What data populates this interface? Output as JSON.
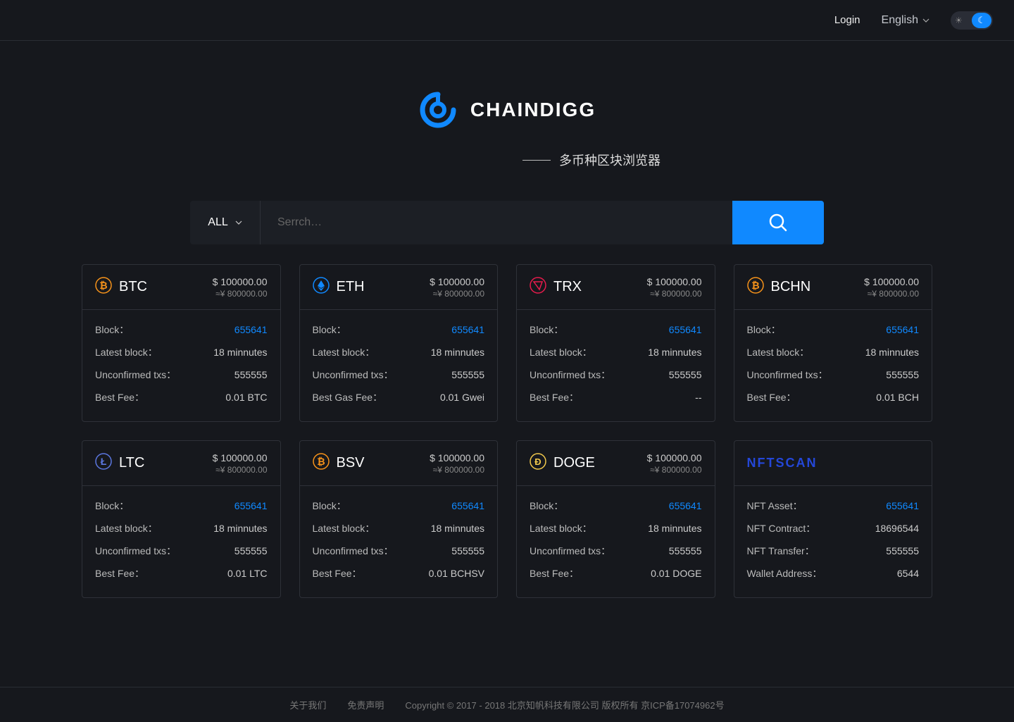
{
  "header": {
    "login": "Login",
    "language": "English"
  },
  "brand": "CHAINDIGG",
  "tagline": "多币种区块浏览器",
  "search": {
    "filter": "ALL",
    "placeholder": "Serrch…"
  },
  "cards": [
    {
      "symbol": "BTC",
      "icon": "btc",
      "iconColor": "#f7931a",
      "priceUsd": "$ 100000.00",
      "priceCny": "≈¥ 800000.00",
      "rows": [
        {
          "label": "Block：",
          "value": "655641",
          "link": true
        },
        {
          "label": "Latest block：",
          "value": "18 minnutes"
        },
        {
          "label": "Unconfirmed txs：",
          "value": "555555"
        },
        {
          "label": "Best Fee：",
          "value": "0.01 BTC"
        }
      ]
    },
    {
      "symbol": "ETH",
      "icon": "eth",
      "iconColor": "#1089ff",
      "priceUsd": "$ 100000.00",
      "priceCny": "≈¥ 800000.00",
      "rows": [
        {
          "label": "Block：",
          "value": "655641",
          "link": true
        },
        {
          "label": "Latest block：",
          "value": "18 minnutes"
        },
        {
          "label": "Unconfirmed txs：",
          "value": "555555"
        },
        {
          "label": "Best Gas Fee：",
          "value": "0.01 Gwei"
        }
      ]
    },
    {
      "symbol": "TRX",
      "icon": "trx",
      "iconColor": "#e61b4c",
      "priceUsd": "$ 100000.00",
      "priceCny": "≈¥ 800000.00",
      "rows": [
        {
          "label": "Block：",
          "value": "655641",
          "link": true
        },
        {
          "label": "Latest block：",
          "value": "18 minnutes"
        },
        {
          "label": "Unconfirmed txs：",
          "value": "555555"
        },
        {
          "label": "Best Fee：",
          "value": "--"
        }
      ]
    },
    {
      "symbol": "BCHN",
      "icon": "bch",
      "iconColor": "#f7931a",
      "priceUsd": "$ 100000.00",
      "priceCny": "≈¥ 800000.00",
      "rows": [
        {
          "label": "Block：",
          "value": "655641",
          "link": true
        },
        {
          "label": "Latest block：",
          "value": "18 minnutes"
        },
        {
          "label": "Unconfirmed txs：",
          "value": "555555"
        },
        {
          "label": "Best Fee：",
          "value": "0.01 BCH"
        }
      ]
    },
    {
      "symbol": "LTC",
      "icon": "ltc",
      "iconColor": "#5b77e0",
      "priceUsd": "$ 100000.00",
      "priceCny": "≈¥ 800000.00",
      "rows": [
        {
          "label": "Block：",
          "value": "655641",
          "link": true
        },
        {
          "label": "Latest block：",
          "value": "18 minnutes"
        },
        {
          "label": "Unconfirmed txs：",
          "value": "555555"
        },
        {
          "label": "Best Fee：",
          "value": "0.01 LTC"
        }
      ]
    },
    {
      "symbol": "BSV",
      "icon": "bsv",
      "iconColor": "#f7931a",
      "priceUsd": "$ 100000.00",
      "priceCny": "≈¥ 800000.00",
      "rows": [
        {
          "label": "Block：",
          "value": "655641",
          "link": true
        },
        {
          "label": "Latest block：",
          "value": "18 minnutes"
        },
        {
          "label": "Unconfirmed txs：",
          "value": "555555"
        },
        {
          "label": "Best Fee：",
          "value": "0.01 BCHSV"
        }
      ]
    },
    {
      "symbol": "DOGE",
      "icon": "doge",
      "iconColor": "#f2c94c",
      "priceUsd": "$ 100000.00",
      "priceCny": "≈¥ 800000.00",
      "rows": [
        {
          "label": "Block：",
          "value": "655641",
          "link": true
        },
        {
          "label": "Latest block：",
          "value": "18 minnutes"
        },
        {
          "label": "Unconfirmed txs：",
          "value": "555555"
        },
        {
          "label": "Best Fee：",
          "value": "0.01 DOGE"
        }
      ]
    },
    {
      "symbol": "NFTSCAN",
      "isNft": true,
      "rows": [
        {
          "label": "NFT Asset：",
          "value": "655641",
          "link": true
        },
        {
          "label": "NFT Contract：",
          "value": "18696544"
        },
        {
          "label": "NFT Transfer：",
          "value": "555555"
        },
        {
          "label": "Wallet Address：",
          "value": "6544"
        }
      ]
    }
  ],
  "footer": {
    "about": "关于我们",
    "disclaimer": "免责声明",
    "copyright": "Copyright © 2017 - 2018 北京知帆科技有限公司 版权所有 京ICP备17074962号"
  }
}
